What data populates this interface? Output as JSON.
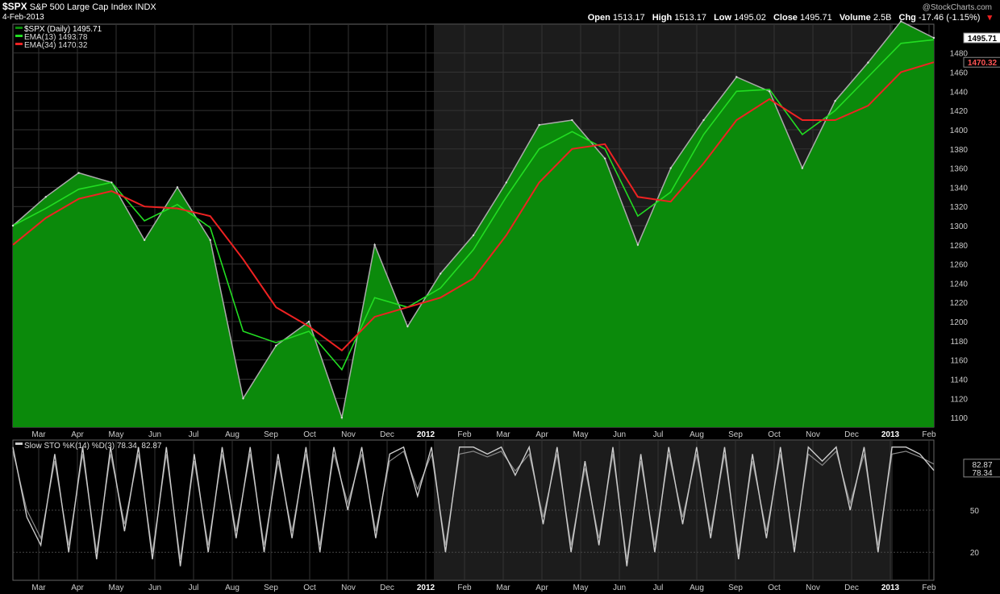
{
  "header": {
    "symbol": "$SPX",
    "name": "S&P 500 Large Cap Index",
    "exchange": "INDX",
    "date": "4-Feb-2013",
    "copyright": "@StockCharts.com",
    "open_label": "Open",
    "open": "1513.17",
    "high_label": "High",
    "high": "1513.17",
    "low_label": "Low",
    "low": "1495.02",
    "close_label": "Close",
    "close": "1495.71",
    "volume_label": "Volume",
    "volume": "2.5B",
    "chg_label": "Chg",
    "chg": "-17.46 (-1.15%)"
  },
  "colors": {
    "price_fill": "#0b8a0b",
    "price_line": "#aaaaaa",
    "ema13": "#22dd22",
    "ema34": "#ee2222",
    "sto": "#cccccc"
  },
  "chart_data": [
    {
      "type": "area",
      "title": "$SPX (Daily) 1495.71",
      "ylim": [
        1090,
        1510
      ],
      "yticks": [
        1100,
        1120,
        1140,
        1160,
        1180,
        1200,
        1220,
        1240,
        1260,
        1280,
        1300,
        1320,
        1340,
        1360,
        1380,
        1400,
        1420,
        1440,
        1460,
        1480
      ],
      "x_ticks": [
        "Mar",
        "Apr",
        "May",
        "Jun",
        "Jul",
        "Aug",
        "Sep",
        "Oct",
        "Nov",
        "Dec",
        "2012",
        "Feb",
        "Mar",
        "Apr",
        "May",
        "Jun",
        "Jul",
        "Aug",
        "Sep",
        "Oct",
        "Nov",
        "Dec",
        "2013",
        "Feb"
      ],
      "x": [
        "2011-02",
        "2011-03",
        "2011-04",
        "2011-05",
        "2011-06",
        "2011-07",
        "2011-08-01",
        "2011-08-08",
        "2011-08-22",
        "2011-09",
        "2011-10-03",
        "2011-10-31",
        "2011-11",
        "2011-12",
        "2012-01",
        "2012-02",
        "2012-03",
        "2012-04",
        "2012-05",
        "2012-06",
        "2012-07",
        "2012-08",
        "2012-09",
        "2012-10",
        "2012-11",
        "2012-12",
        "2013-01",
        "2013-02-01",
        "2013-02-04"
      ],
      "series": [
        {
          "name": "$SPX (Daily) 1495.71",
          "label": "1495.71",
          "values": [
            1300,
            1330,
            1355,
            1345,
            1285,
            1340,
            1285,
            1120,
            1175,
            1200,
            1100,
            1280,
            1195,
            1250,
            1290,
            1345,
            1405,
            1410,
            1370,
            1280,
            1360,
            1410,
            1455,
            1440,
            1360,
            1430,
            1470,
            1513,
            1495.71
          ]
        },
        {
          "name": "EMA(13) 1493.78",
          "label": "1493.78",
          "values": [
            1300,
            1318,
            1338,
            1345,
            1305,
            1322,
            1298,
            1190,
            1178,
            1190,
            1150,
            1225,
            1215,
            1235,
            1275,
            1330,
            1380,
            1398,
            1380,
            1310,
            1335,
            1395,
            1440,
            1442,
            1395,
            1420,
            1455,
            1490,
            1493.78
          ]
        },
        {
          "name": "EMA(34) 1470.32",
          "label": "1470.32",
          "values": [
            1280,
            1308,
            1328,
            1336,
            1320,
            1318,
            1310,
            1265,
            1215,
            1195,
            1170,
            1205,
            1215,
            1225,
            1245,
            1290,
            1345,
            1380,
            1385,
            1330,
            1325,
            1365,
            1410,
            1432,
            1410,
            1410,
            1425,
            1460,
            1470.32
          ]
        }
      ]
    },
    {
      "type": "line",
      "title": "Slow STO %K(14) %D(3) 78.34, 82.87",
      "ylim": [
        0,
        100
      ],
      "yticks": [
        20,
        50
      ],
      "x_ticks": [
        "Mar",
        "Apr",
        "May",
        "Jun",
        "Jul",
        "Aug",
        "Sep",
        "Oct",
        "Nov",
        "Dec",
        "2012",
        "Feb",
        "Mar",
        "Apr",
        "May",
        "Jun",
        "Jul",
        "Aug",
        "Sep",
        "Oct",
        "Nov",
        "Dec",
        "2013",
        "Feb"
      ],
      "series": [
        {
          "name": "%K(14)",
          "label": "78.34",
          "values": [
            95,
            45,
            25,
            90,
            20,
            95,
            15,
            95,
            35,
            95,
            15,
            95,
            10,
            90,
            20,
            95,
            30,
            95,
            20,
            90,
            30,
            95,
            20,
            95,
            50,
            95,
            30,
            90,
            95,
            60,
            95,
            20,
            95,
            95,
            90,
            95,
            75,
            95,
            40,
            95,
            20,
            85,
            25,
            95,
            10,
            90,
            20,
            95,
            40,
            95,
            30,
            95,
            15,
            90,
            30,
            95,
            20,
            95,
            85,
            95,
            50,
            95,
            20,
            95,
            95,
            90,
            78.34
          ]
        },
        {
          "name": "%D(3)",
          "label": "82.87",
          "values": [
            92,
            50,
            30,
            85,
            25,
            90,
            20,
            90,
            40,
            90,
            20,
            90,
            15,
            85,
            25,
            90,
            35,
            90,
            25,
            85,
            35,
            90,
            25,
            90,
            55,
            90,
            35,
            85,
            92,
            65,
            90,
            25,
            90,
            92,
            88,
            92,
            78,
            90,
            45,
            90,
            25,
            80,
            30,
            90,
            15,
            85,
            25,
            90,
            45,
            90,
            35,
            90,
            20,
            85,
            35,
            90,
            25,
            90,
            82,
            92,
            55,
            90,
            25,
            90,
            92,
            88,
            82.87
          ]
        }
      ]
    }
  ]
}
